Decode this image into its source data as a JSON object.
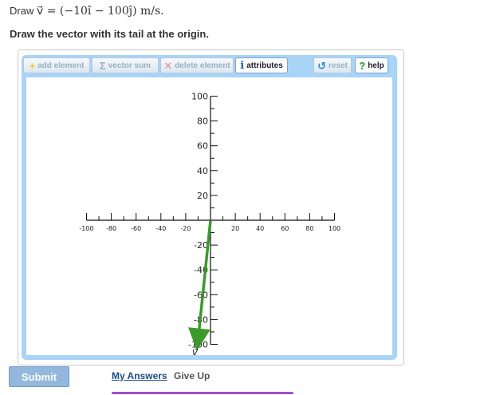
{
  "prompt": {
    "prefix": "Draw",
    "math": "v⃗ = (−10î − 100ĵ) m/s."
  },
  "instruction": "Draw the vector with its tail at the origin.",
  "toolbar": {
    "add_element": "add element",
    "vector_sum": "vector sum",
    "delete_element": "delete element",
    "attributes": "attributes",
    "reset": "reset",
    "help": "help"
  },
  "icons": {
    "add": "plus-icon",
    "sum": "sigma-icon",
    "delete": "x-icon",
    "attributes": "info-icon",
    "reset": "reset-icon",
    "help": "question-icon"
  },
  "graph": {
    "x_ticks": [
      "-100",
      "-80",
      "-60",
      "-40",
      "-20",
      "20",
      "40",
      "60",
      "80",
      "100"
    ],
    "y_ticks_pos": [
      "100",
      "80",
      "60",
      "40",
      "20"
    ],
    "y_ticks_neg": [
      "-20",
      "-40",
      "-60",
      "-80",
      "-100"
    ],
    "vector": {
      "x": -10,
      "y": -100,
      "label": "v⃗",
      "color": "#3a9a2a"
    }
  },
  "buttons": {
    "submit": "Submit",
    "my_answers": "My Answers",
    "give_up": "Give Up"
  },
  "colors": {
    "panel": "#a8d4f7",
    "submit": "#93b8dc",
    "link": "#1b4c8a"
  }
}
